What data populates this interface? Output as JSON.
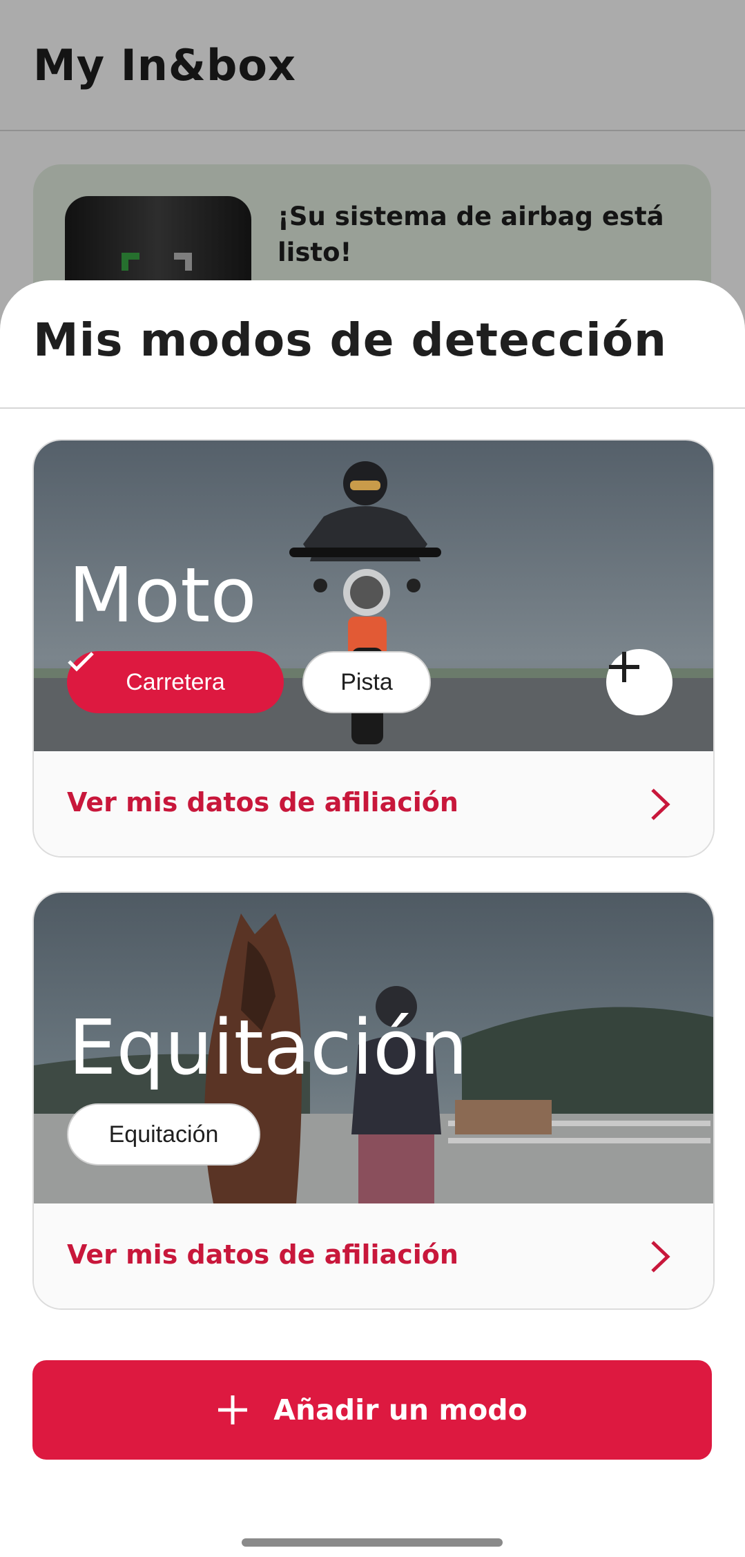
{
  "background_screen": {
    "title": "My In&box",
    "status_message": "¡Su sistema de airbag está listo!"
  },
  "sheet": {
    "title": "Mis modos de detección"
  },
  "modes": [
    {
      "name": "Moto",
      "chips": [
        {
          "label": "Carretera",
          "selected": true
        },
        {
          "label": "Pista",
          "selected": false
        }
      ],
      "has_add_chip": true,
      "link_label": "Ver mis datos de afiliación"
    },
    {
      "name": "Equitación",
      "chips": [
        {
          "label": "Equitación",
          "selected": false
        }
      ],
      "has_add_chip": false,
      "link_label": "Ver mis datos de afiliación"
    }
  ],
  "add_mode_button": {
    "label": "Añadir un modo",
    "icon": "plus-icon"
  },
  "colors": {
    "accent": "#dd1940",
    "link": "#c8173b",
    "status_card": "#e4efe2"
  }
}
